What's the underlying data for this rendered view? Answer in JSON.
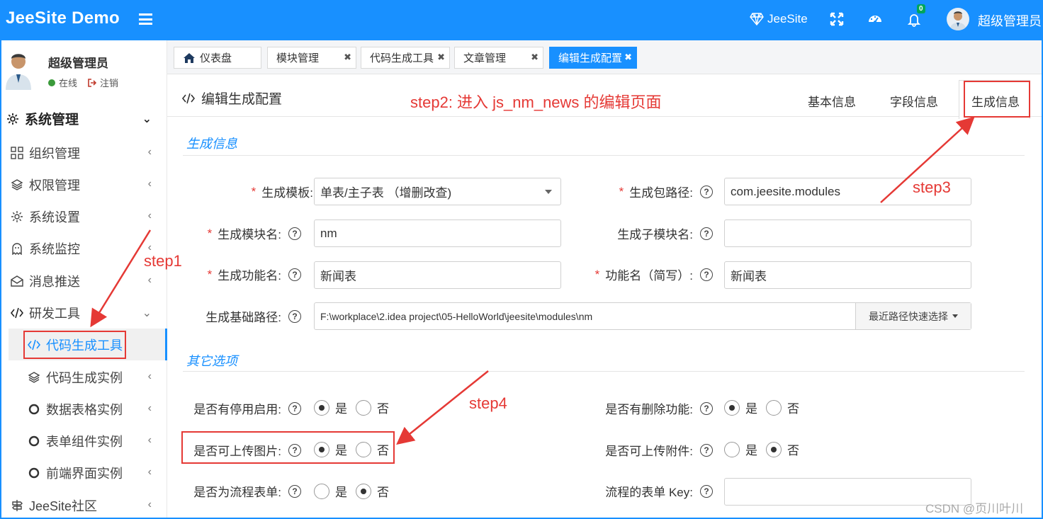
{
  "topbar": {
    "brand": "JeeSite Demo",
    "jeesite_link": "JeeSite",
    "notification_count": "0",
    "user_name": "超级管理员",
    "icons": [
      "menu-icon",
      "diamond-icon",
      "fullscreen-icon",
      "dashboard-icon",
      "notification-icon"
    ]
  },
  "sidebar": {
    "user": {
      "name": "超级管理员",
      "status": "在线",
      "logout": "注销"
    },
    "items": [
      {
        "label": "系统管理",
        "icon": "gear-icon"
      },
      {
        "label": "组织管理",
        "icon": "grid-icon"
      },
      {
        "label": "权限管理",
        "icon": "layers-icon"
      },
      {
        "label": "系统设置",
        "icon": "gear-icon"
      },
      {
        "label": "系统监控",
        "icon": "ghost-icon"
      },
      {
        "label": "消息推送",
        "icon": "envelope-icon"
      },
      {
        "label": "研发工具",
        "icon": "code-icon"
      },
      {
        "label": "代码生成工具",
        "icon": "code-icon"
      },
      {
        "label": "代码生成实例",
        "icon": "layers-icon"
      },
      {
        "label": "数据表格实例",
        "icon": "circle-icon"
      },
      {
        "label": "表单组件实例",
        "icon": "circle-icon"
      },
      {
        "label": "前端界面实例",
        "icon": "circle-icon"
      },
      {
        "label": "JeeSite社区",
        "icon": "signpost-icon"
      }
    ]
  },
  "tabs": [
    {
      "label": "仪表盘"
    },
    {
      "label": "模块管理"
    },
    {
      "label": "代码生成工具"
    },
    {
      "label": "文章管理"
    },
    {
      "label": "编辑生成配置"
    }
  ],
  "page": {
    "title": "编辑生成配置",
    "subtabs": [
      "基本信息",
      "字段信息",
      "生成信息"
    ]
  },
  "section_gen": {
    "title": "生成信息",
    "template_label": "生成模板:",
    "template_value": "单表/主子表 （增删改查)",
    "package_label": "生成包路径:",
    "package_value": "com.jeesite.modules",
    "module_label": "生成模块名:",
    "module_value": "nm",
    "submodule_label": "生成子模块名:",
    "submodule_value": "",
    "function_label": "生成功能名:",
    "function_value": "新闻表",
    "short_label": "功能名（简写）:",
    "short_value": "新闻表",
    "path_label": "生成基础路径:",
    "path_value": "F:\\workplace\\2.idea project\\05-HelloWorld\\jeesite\\modules\\nm",
    "path_button": "最近路径快速选择"
  },
  "section_other": {
    "title": "其它选项",
    "yes": "是",
    "no": "否",
    "disable_label": "是否有停用启用:",
    "delete_label": "是否有删除功能:",
    "image_label": "是否可上传图片:",
    "attach_label": "是否可上传附件:",
    "flow_label": "是否为流程表单:",
    "flowkey_label": "流程的表单 Key:",
    "flowkey_value": ""
  },
  "annotations": {
    "step1": "step1",
    "step2": "step2: 进入 js_nm_news 的编辑页面",
    "step3": "step3",
    "step4": "step4"
  },
  "watermark": "CSDN @页川叶川",
  "colors": {
    "primary": "#1890ff",
    "annotation": "#e53935"
  }
}
